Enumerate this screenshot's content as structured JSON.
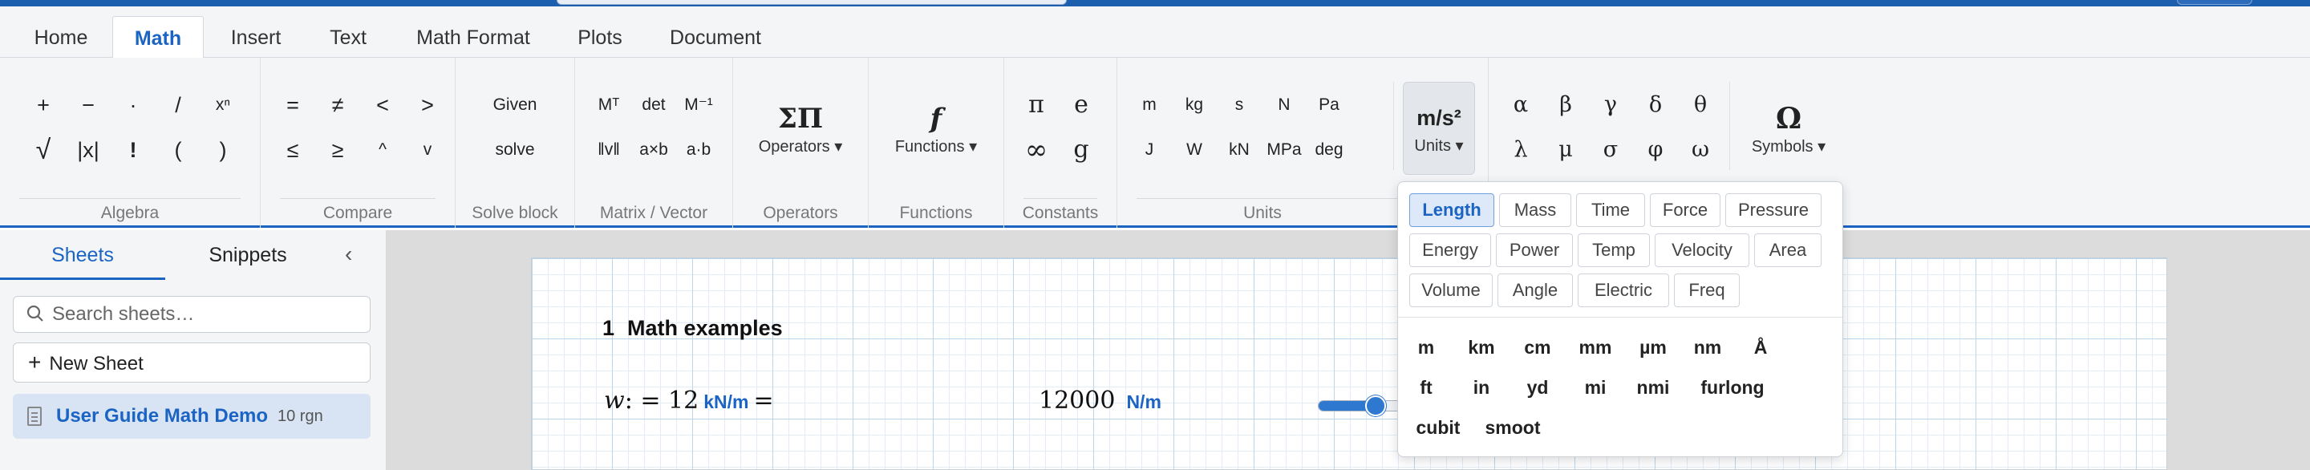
{
  "tabs": [
    "Home",
    "Math",
    "Insert",
    "Text",
    "Math Format",
    "Plots",
    "Document"
  ],
  "active_tab": "Math",
  "ribbon": {
    "algebra": {
      "row1": [
        "+",
        "−",
        "·",
        "/",
        "xⁿ"
      ],
      "row2": [
        "√",
        "|x|",
        "!",
        "(",
        ")"
      ],
      "label": "Algebra"
    },
    "compare": {
      "row1": [
        "=",
        "≠",
        "<",
        ">"
      ],
      "row2": [
        "≤",
        "≥",
        "^",
        "v"
      ],
      "label": "Compare"
    },
    "solve_block": {
      "items": [
        "Given",
        "solve"
      ],
      "label": "Solve block"
    },
    "matrix_vector": {
      "row1": [
        "Mᵀ",
        "det",
        "M⁻¹"
      ],
      "row2": [
        "‖v‖",
        "a×b",
        "a·b"
      ],
      "label": "Matrix / Vector"
    },
    "operators": {
      "icon": "ΣΠ",
      "button": "Operators ▾",
      "label": "Operators"
    },
    "functions": {
      "icon": "f",
      "button": "Functions ▾",
      "label": "Functions"
    },
    "constants": {
      "row1": [
        "π",
        "e"
      ],
      "row2": [
        "∞",
        "g"
      ],
      "label": "Constants"
    },
    "units": {
      "row1": [
        "m",
        "kg",
        "s",
        "N",
        "Pa"
      ],
      "row2": [
        "J",
        "W",
        "kN",
        "MPa",
        "deg"
      ],
      "big_icon": "m/s²",
      "big_button": "Units ▾",
      "label": "Units"
    },
    "greek": {
      "row1": [
        "α",
        "β",
        "γ",
        "δ",
        "θ"
      ],
      "row2": [
        "λ",
        "μ",
        "σ",
        "φ",
        "ω"
      ]
    },
    "symbols": {
      "icon": "Ω",
      "button": "Symbols ▾"
    }
  },
  "sidebar": {
    "tabs": [
      "Sheets",
      "Snippets"
    ],
    "active": "Sheets",
    "collapse_glyph": "‹",
    "search_placeholder": "Search sheets…",
    "new_sheet_label": "New Sheet",
    "sheets": [
      {
        "name": "User Guide Math Demo",
        "count": "10 rgn"
      }
    ]
  },
  "document": {
    "heading_number": "1",
    "heading_text": "Math examples",
    "expr_var": "w",
    "expr_assign": ": = 12",
    "expr_unit": "kN/m",
    "expr_eq": "=",
    "result_value": "12000",
    "result_unit": "N/m",
    "slider_fraction": 0.48
  },
  "units_menu": {
    "categories": [
      [
        "Length",
        "Mass",
        "Time",
        "Force",
        "Pressure"
      ],
      [
        "Energy",
        "Power",
        "Temp",
        "Velocity",
        "Area"
      ],
      [
        "Volume",
        "Angle",
        "Electric",
        "Freq"
      ]
    ],
    "active_category": "Length",
    "units": [
      [
        "m",
        "km",
        "cm",
        "mm",
        "µm",
        "nm",
        "Å"
      ],
      [
        "ft",
        "in",
        "yd",
        "mi",
        "nmi",
        "furlong"
      ],
      [
        "cubit",
        "smoot"
      ]
    ]
  },
  "colors": {
    "accent": "#1b64c4",
    "topbar": "#1c5fae",
    "selected_bg": "#d8e4f3"
  }
}
